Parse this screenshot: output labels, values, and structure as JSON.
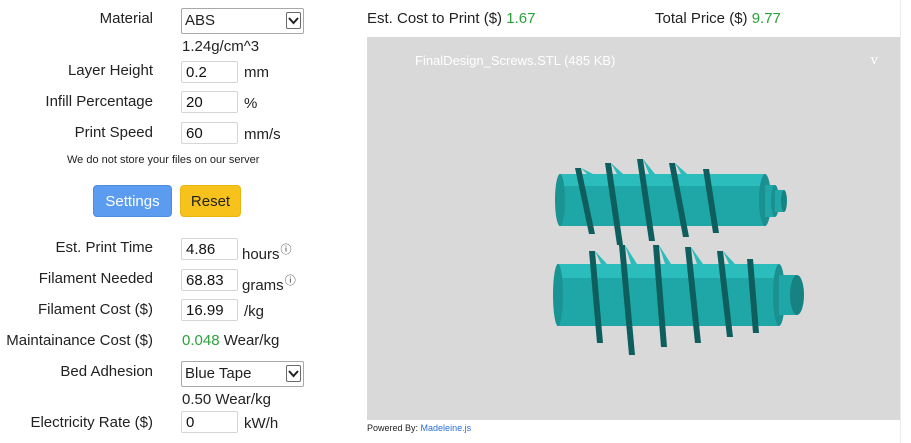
{
  "form": {
    "material": {
      "label": "Material",
      "value": "ABS",
      "density": "1.24g/cm^3"
    },
    "layer_height": {
      "label": "Layer Height",
      "value": "0.2",
      "unit": "mm"
    },
    "infill": {
      "label": "Infill Percentage",
      "value": "20",
      "unit": "%"
    },
    "print_speed": {
      "label": "Print Speed",
      "value": "60",
      "unit": "mm/s"
    },
    "privacy_note": "We do not store your files on our server",
    "settings_button": "Settings",
    "reset_button": "Reset",
    "print_time": {
      "label": "Est. Print Time",
      "value": "4.86",
      "unit": "hours"
    },
    "filament_needed": {
      "label": "Filament Needed",
      "value": "68.83",
      "unit": "grams"
    },
    "filament_cost": {
      "label": "Filament Cost ($)",
      "value": "16.99",
      "unit": "/kg"
    },
    "maintenance_cost": {
      "label": "Maintainance Cost ($)",
      "value": "0.048",
      "unit": "Wear/kg"
    },
    "bed_adhesion": {
      "label": "Bed Adhesion",
      "value": "Blue Tape",
      "wear": "0.50 Wear/kg"
    },
    "electricity": {
      "label": "Electricity Rate ($)",
      "value": "0",
      "unit": "kW/h"
    }
  },
  "summary": {
    "cost_label": "Est. Cost to Print ($)",
    "cost_value": "1.67",
    "total_label": "Total Price ($)",
    "total_value": "9.77"
  },
  "viewer": {
    "filename": "FinalDesign_Screws.STL (485 KB)",
    "toggle": "v",
    "powered_by": "Powered By:",
    "powered_link": "Madeleine.js"
  },
  "colors": {
    "accent_green": "#2aa23a",
    "settings_btn": "#5b9cf0",
    "reset_btn": "#f6c21b",
    "model": "#1fa6a6",
    "viewer_bg": "#d9d9d9"
  },
  "icons": {
    "info": "info-circle-icon",
    "dropdown": "chevron-down-icon"
  }
}
